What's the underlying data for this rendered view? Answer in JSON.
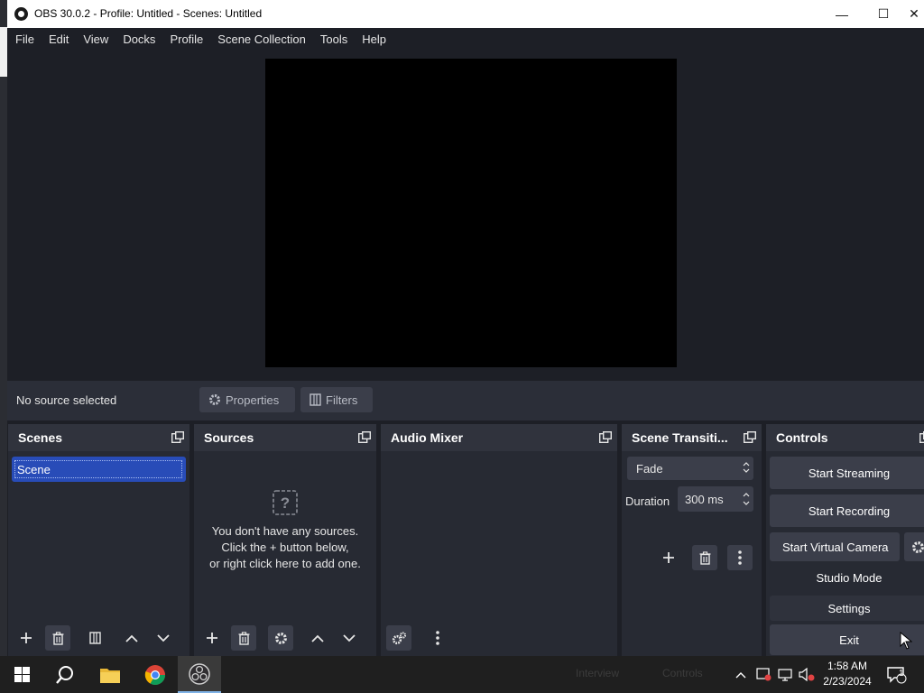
{
  "window": {
    "title": "OBS 30.0.2 - Profile: Untitled - Scenes: Untitled",
    "min_glyph": "—",
    "max_glyph": "☐",
    "close_glyph": "✕"
  },
  "menubar": {
    "items": [
      "File",
      "Edit",
      "View",
      "Docks",
      "Profile",
      "Scene Collection",
      "Tools",
      "Help"
    ]
  },
  "source_bar": {
    "status": "No source selected",
    "properties_label": "Properties",
    "filters_label": "Filters"
  },
  "docks": {
    "scenes": {
      "title": "Scenes",
      "items": [
        "Scene"
      ]
    },
    "sources": {
      "title": "Sources",
      "empty_line1": "You don't have any sources.",
      "empty_line2": "Click the + button below,",
      "empty_line3": "or right click here to add one."
    },
    "mixer": {
      "title": "Audio Mixer"
    },
    "transitions": {
      "title": "Scene Transiti...",
      "selected": "Fade",
      "duration_label": "Duration",
      "duration_value": "300 ms"
    },
    "controls": {
      "title": "Controls",
      "buttons": [
        "Start Streaming",
        "Start Recording",
        "Start Virtual Camera",
        "Studio Mode",
        "Settings",
        "Exit"
      ]
    }
  },
  "taskbar": {
    "time": "1:58 AM",
    "date": "2/23/2024",
    "notification_count": "1",
    "faint_left": "Interview",
    "faint_right": "Controls"
  },
  "colors": {
    "accent": "#284cb8",
    "panel": "#272a33",
    "button": "#3b3e4a"
  }
}
